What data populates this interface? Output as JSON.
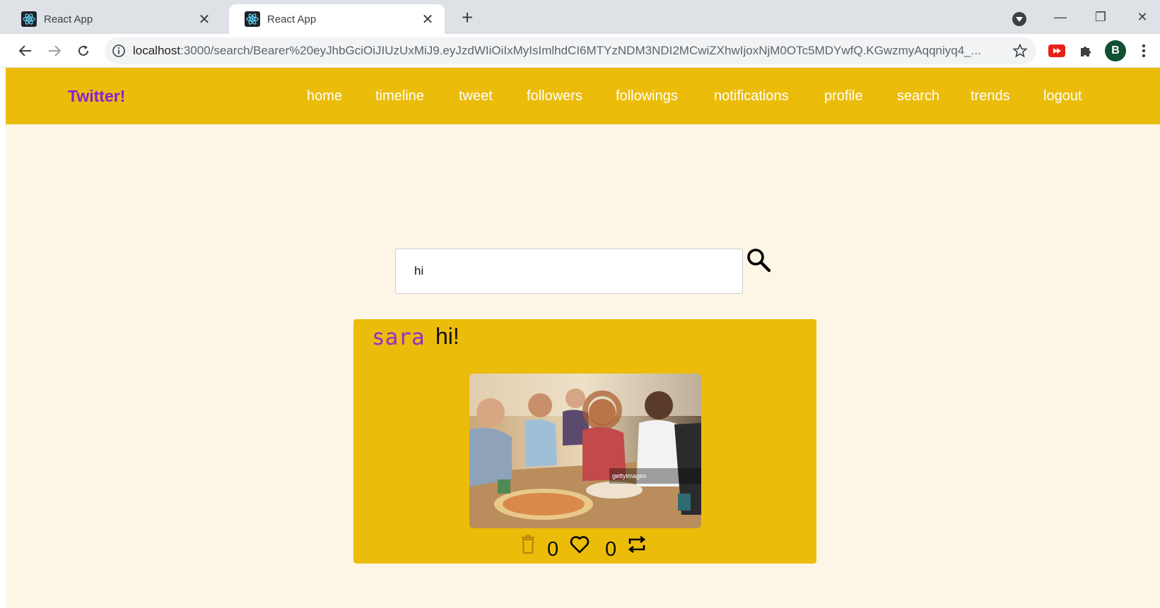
{
  "browser": {
    "tabs": [
      {
        "title": "React App",
        "active": false
      },
      {
        "title": "React App",
        "active": true
      }
    ],
    "url_host": "localhost",
    "url_rest": ":3000/search/Bearer%20eyJhbGciOiJIUzUxMiJ9.eyJzdWIiOiIxMyIsImlhdCI6MTYzNDM3NDI2MCwiZXhwIjoxNjM0OTc5MDYwfQ.KGwzmyAqqniyq4_...",
    "profile_initial": "B",
    "icons": {
      "favicon": "react-logo-icon",
      "back": "back-arrow-icon",
      "forward": "forward-arrow-icon",
      "reload": "reload-icon",
      "info": "info-icon",
      "bookmark": "star-icon",
      "extension1": "youtube-extension-icon",
      "extension2": "puzzle-icon",
      "menu": "kebab-menu-icon"
    }
  },
  "app": {
    "brand": "Twitter!",
    "nav": [
      "home",
      "timeline",
      "tweet",
      "followers",
      "followings",
      "notifications",
      "profile",
      "search",
      "trends",
      "logout"
    ],
    "search": {
      "value": "hi",
      "placeholder": ""
    },
    "tweet": {
      "user": "sara",
      "text": "hi!",
      "likes": "0",
      "retweets": "0",
      "photo_watermark": "gettyimages"
    }
  },
  "colors": {
    "navbar": "#ebbc0a",
    "brand": "#8b1fd0",
    "page_bg": "#fdf5e6",
    "card": "#ebbc0a",
    "username": "#9a2bcf"
  }
}
